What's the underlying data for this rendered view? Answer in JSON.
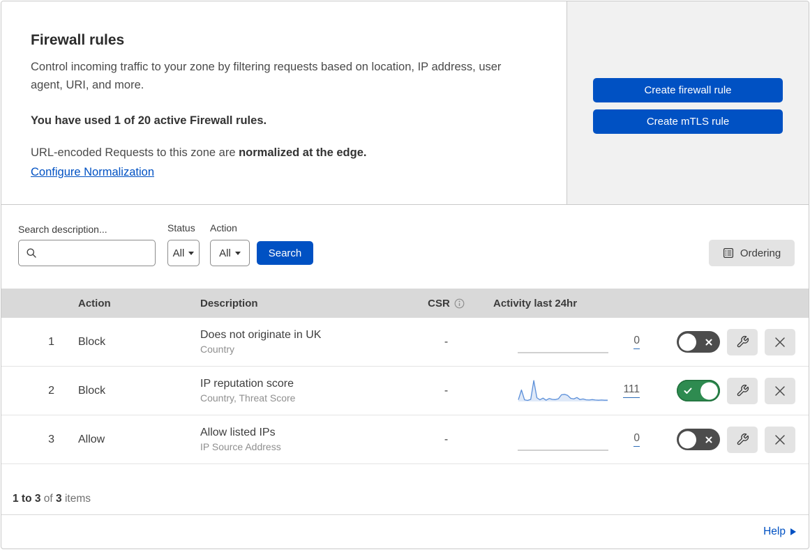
{
  "page": {
    "title": "Firewall rules",
    "description": "Control incoming traffic to your zone by filtering requests based on location, IP address, user agent, URI, and more.",
    "usage_notice": "You have used 1 of 20 active Firewall rules.",
    "normalization_prefix": "URL-encoded Requests to this zone are ",
    "normalization_bold": "normalized at the edge.",
    "normalization_link": "Configure Normalization"
  },
  "actions": {
    "create_firewall_rule": "Create firewall rule",
    "create_mtls_rule": "Create mTLS rule"
  },
  "filters": {
    "search_label": "Search description...",
    "search_placeholder": "",
    "search_value": "",
    "status_label": "Status",
    "status_value": "All",
    "action_label": "Action",
    "action_value": "All",
    "search_button_label": "Search",
    "ordering_button_label": "Ordering"
  },
  "table": {
    "headers": {
      "action": "Action",
      "description": "Description",
      "csr": "CSR",
      "activity": "Activity last 24hr"
    },
    "rows": [
      {
        "priority": "1",
        "action": "Block",
        "description": "Does not originate in UK",
        "fields": "Country",
        "csr": "-",
        "activity_count": "0",
        "enabled": false,
        "sparkline": []
      },
      {
        "priority": "2",
        "action": "Block",
        "description": "IP reputation score",
        "fields": "Country, Threat Score",
        "csr": "-",
        "activity_count": "111",
        "enabled": true,
        "sparkline": [
          8,
          55,
          8,
          5,
          10,
          100,
          18,
          8,
          16,
          6,
          14,
          10,
          9,
          13,
          32,
          34,
          29,
          15,
          12,
          19,
          9,
          12,
          8,
          7,
          9,
          7,
          6,
          7,
          6,
          6
        ]
      },
      {
        "priority": "3",
        "action": "Allow",
        "description": "Allow listed IPs",
        "fields": "IP Source Address",
        "csr": "-",
        "activity_count": "0",
        "enabled": false,
        "sparkline": []
      }
    ]
  },
  "footer": {
    "range": "1 to 3",
    "of": " of ",
    "total": "3",
    "items": " items",
    "help_label": "Help"
  },
  "colors": {
    "primary_blue": "#0051c3",
    "toggle_on_green": "#2e8b50",
    "toggle_off_gray": "#4c4c4c",
    "sparkline_stroke": "#5b8fd9",
    "sparkline_fill": "#dfe9f8",
    "flat_line_gray": "#b5b5b5",
    "table_header_bg": "#d9d9d9",
    "panel_bg": "#f1f1f1"
  }
}
